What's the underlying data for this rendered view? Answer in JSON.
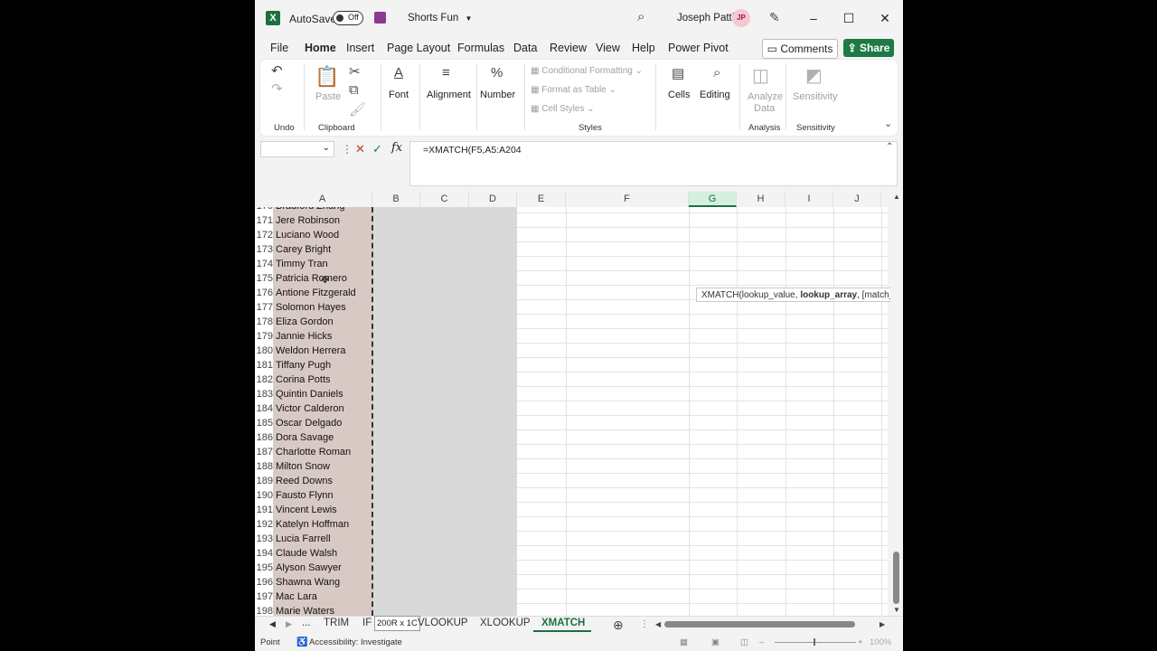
{
  "titlebar": {
    "autosave_label": "AutoSave",
    "autosave_state": "Off",
    "file_name": "Shorts Fun",
    "user_name": "Joseph Patti",
    "user_initials": "JP"
  },
  "menu": {
    "tabs": [
      "File",
      "Home",
      "Insert",
      "Page Layout",
      "Formulas",
      "Data",
      "Review",
      "View",
      "Help",
      "Power Pivot"
    ],
    "active": "Home",
    "comments_label": "Comments",
    "share_label": "Share"
  },
  "ribbon": {
    "undo_group": "Undo",
    "paste_label": "Paste",
    "clipboard_group": "Clipboard",
    "font_label": "Font",
    "alignment_label": "Alignment",
    "number_label": "Number",
    "conditional_formatting": "Conditional Formatting",
    "format_as_table": "Format as Table",
    "cell_styles": "Cell Styles",
    "styles_group": "Styles",
    "cells_label": "Cells",
    "editing_label": "Editing",
    "analyze_data_line1": "Analyze",
    "analyze_data_line2": "Data",
    "analysis_group": "Analysis",
    "sensitivity_label": "Sensitivity",
    "sensitivity_group": "Sensitivity"
  },
  "formula_bar": {
    "formula": "=XMATCH(F5,A5:A204",
    "fx": "fx"
  },
  "columns": [
    "A",
    "B",
    "C",
    "D",
    "E",
    "F",
    "G",
    "H",
    "I",
    "J"
  ],
  "selected_column": "G",
  "rows": [
    {
      "num": "170",
      "a": "Bradford Zhang"
    },
    {
      "num": "171",
      "a": "Jere Robinson"
    },
    {
      "num": "172",
      "a": "Luciano Wood"
    },
    {
      "num": "173",
      "a": "Carey Bright"
    },
    {
      "num": "174",
      "a": "Timmy Tran"
    },
    {
      "num": "175",
      "a": "Patricia Romero"
    },
    {
      "num": "176",
      "a": "Antione Fitzgerald"
    },
    {
      "num": "177",
      "a": "Solomon Hayes"
    },
    {
      "num": "178",
      "a": "Eliza Gordon"
    },
    {
      "num": "179",
      "a": "Jannie Hicks"
    },
    {
      "num": "180",
      "a": "Weldon Herrera"
    },
    {
      "num": "181",
      "a": "Tiffany Pugh"
    },
    {
      "num": "182",
      "a": "Corina Potts"
    },
    {
      "num": "183",
      "a": "Quintin Daniels"
    },
    {
      "num": "184",
      "a": "Victor Calderon"
    },
    {
      "num": "185",
      "a": "Oscar Delgado"
    },
    {
      "num": "186",
      "a": "Dora Savage"
    },
    {
      "num": "187",
      "a": "Charlotte Roman"
    },
    {
      "num": "188",
      "a": "Milton Snow"
    },
    {
      "num": "189",
      "a": "Reed Downs"
    },
    {
      "num": "190",
      "a": "Fausto Flynn"
    },
    {
      "num": "191",
      "a": "Vincent Lewis"
    },
    {
      "num": "192",
      "a": "Katelyn Hoffman"
    },
    {
      "num": "193",
      "a": "Lucia Farrell"
    },
    {
      "num": "194",
      "a": "Claude Walsh"
    },
    {
      "num": "195",
      "a": "Alyson Sawyer"
    },
    {
      "num": "196",
      "a": "Shawna Wang"
    },
    {
      "num": "197",
      "a": "Mac Lara"
    },
    {
      "num": "198",
      "a": "Marie Waters"
    }
  ],
  "tooltip": {
    "fn": "XMATCH(lookup_value, ",
    "bold_arg": "lookup_array",
    "rest": ", [match_mo"
  },
  "sheet_tabs": {
    "ellipsis": "...",
    "trim": "TRIM",
    "if": "IF",
    "size_tip": "200R x 1C",
    "vlookup": "VLOOKUP",
    "xlookup": "XLOOKUP",
    "xmatch": "XMATCH",
    "active": "XMATCH"
  },
  "status": {
    "mode": "Point",
    "accessibility": "Accessibility: Investigate",
    "zoom": "100%"
  },
  "colors": {
    "accent": "#1d6f42",
    "selected_range": "#d9c9c5",
    "column_shade": "#d9d9d9"
  }
}
